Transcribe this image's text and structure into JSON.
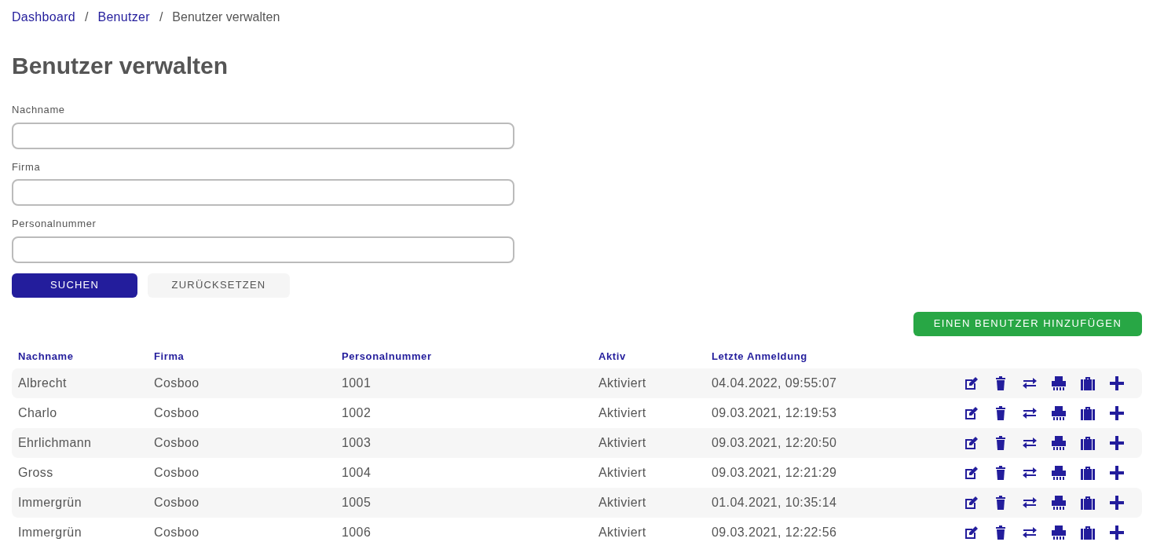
{
  "breadcrumb": [
    {
      "label": "Dashboard",
      "link": true
    },
    {
      "label": "Benutzer",
      "link": true
    },
    {
      "label": "Benutzer verwalten",
      "link": false
    }
  ],
  "breadcrumb_separators": [
    "/",
    "/"
  ],
  "title": "Benutzer verwalten",
  "filters": [
    {
      "label": "Nachname"
    },
    {
      "label": "Firma"
    },
    {
      "label": "Personalnummer"
    }
  ],
  "buttons": {
    "search": "SUCHEN",
    "reset": "ZURÜCKSETZEN",
    "add": "EINEN BENUTZER HINZUFÜGEN"
  },
  "table": {
    "columns": [
      "Nachname",
      "Firma",
      "Personalnummer",
      "Aktiv",
      "Letzte Anmeldung"
    ],
    "rows": [
      [
        "Albrecht",
        "Cosboo",
        "1001",
        "Aktiviert",
        "04.04.2022, 09:55:07"
      ],
      [
        "Charlo",
        "Cosboo",
        "1002",
        "Aktiviert",
        "09.03.2021, 12:19:53"
      ],
      [
        "Ehrlichmann",
        "Cosboo",
        "1003",
        "Aktiviert",
        "09.03.2021, 12:20:50"
      ],
      [
        "Gross",
        "Cosboo",
        "1004",
        "Aktiviert",
        "09.03.2021, 12:21:29"
      ],
      [
        "Immergrün",
        "Cosboo",
        "1005",
        "Aktiviert",
        "01.04.2021, 10:35:14"
      ],
      [
        "Immergrün",
        "Cosboo",
        "1006",
        "Aktiviert",
        "09.03.2021, 12:22:56"
      ]
    ]
  }
}
